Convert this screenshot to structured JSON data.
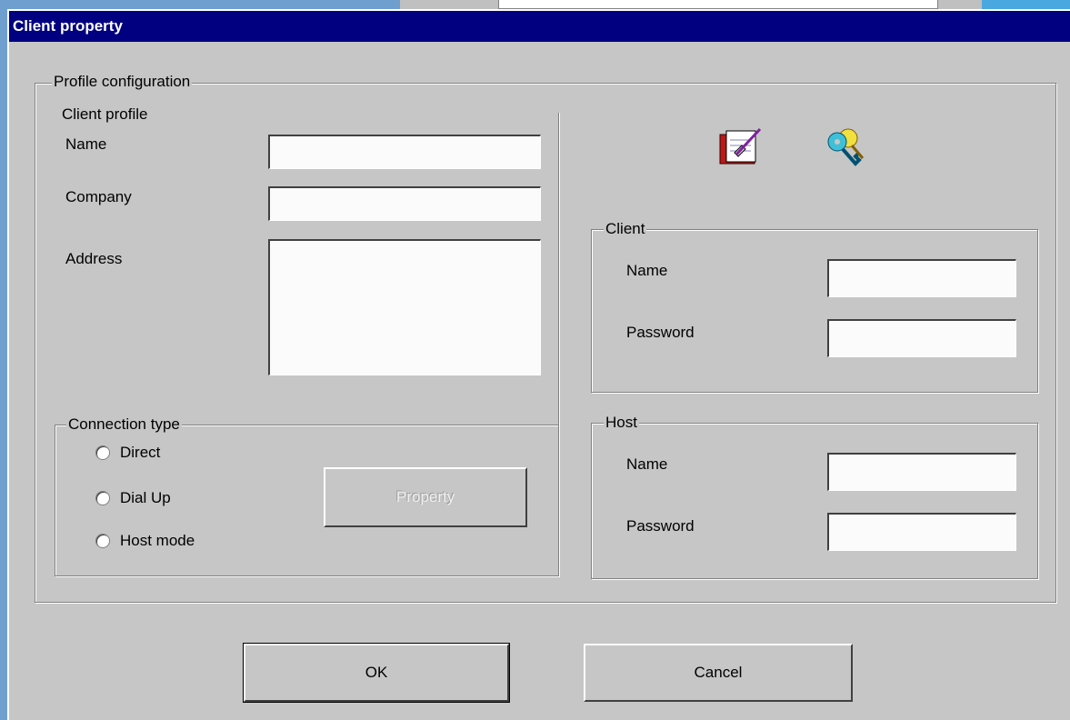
{
  "dialog": {
    "title": "Client property",
    "profile_group": "Profile configuration",
    "client_profile": {
      "heading": "Client profile",
      "name_label": "Name",
      "company_label": "Company",
      "address_label": "Address",
      "name_value": "",
      "company_value": "",
      "address_value": ""
    },
    "connection_type": {
      "legend": "Connection type",
      "options": [
        "Direct",
        "Dial Up",
        "Host mode"
      ],
      "property_button": "Property"
    },
    "client_group": {
      "legend": "Client",
      "name_label": "Name",
      "password_label": "Password",
      "name_value": "",
      "password_value": ""
    },
    "host_group": {
      "legend": "Host",
      "name_label": "Name",
      "password_label": "Password",
      "name_value": "",
      "password_value": ""
    },
    "buttons": {
      "ok": "OK",
      "cancel": "Cancel"
    },
    "icons": [
      "notebook-pen-icon",
      "keys-icon"
    ]
  },
  "colors": {
    "title_bar": "#000080",
    "dialog_face": "#c6c6c6",
    "desktop": "#6f9fcf"
  }
}
